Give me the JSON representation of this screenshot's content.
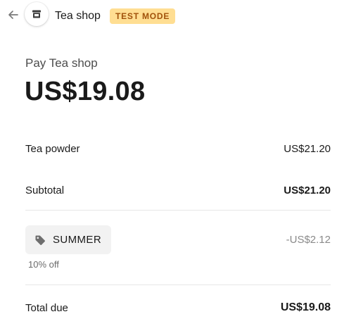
{
  "header": {
    "back_icon": "arrow-left-icon",
    "shop_icon": "storefront-icon",
    "shop_name": "Tea shop",
    "badge": "TEST MODE",
    "badge_bg": "#ffde92",
    "badge_color": "#a1520b"
  },
  "summary": {
    "pay_label": "Pay Tea shop",
    "amount": "US$19.08"
  },
  "line_items": [
    {
      "name": "Tea powder",
      "price": "US$21.20"
    }
  ],
  "subtotal": {
    "label": "Subtotal",
    "value": "US$21.20"
  },
  "promotion": {
    "icon": "tag-icon",
    "code": "SUMMER",
    "description": "10% off",
    "discount": "-US$2.12"
  },
  "total": {
    "label": "Total due",
    "value": "US$19.08"
  }
}
